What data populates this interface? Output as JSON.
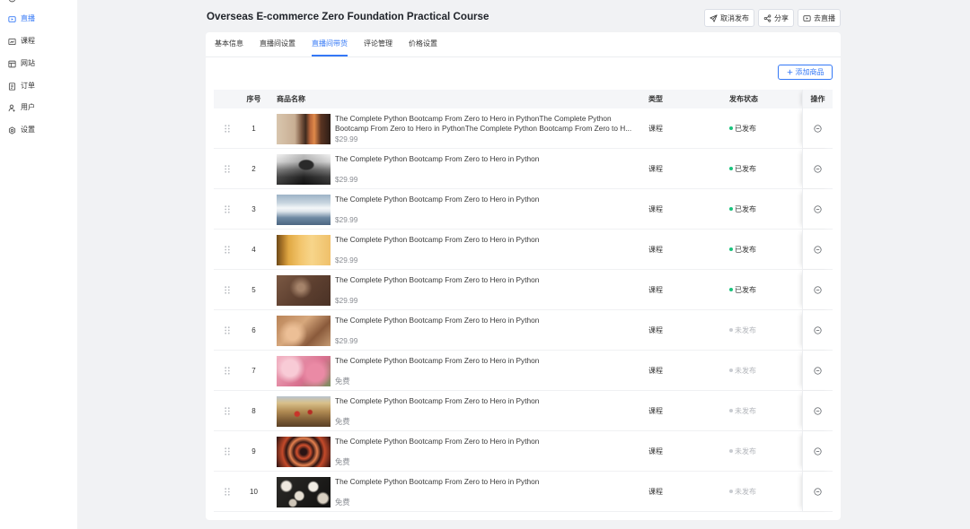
{
  "theme": {
    "accent": "#3478f6",
    "published": "#19c37d",
    "unpublished": "#c8cbd0"
  },
  "sidebar": {
    "items": [
      {
        "label": "直播",
        "icon": "video-icon",
        "active": true
      },
      {
        "label": "课程",
        "icon": "course-icon"
      },
      {
        "label": "网站",
        "icon": "website-icon"
      },
      {
        "label": "订单",
        "icon": "order-icon"
      },
      {
        "label": "用户",
        "icon": "user-icon"
      },
      {
        "label": "设置",
        "icon": "gear-icon"
      }
    ]
  },
  "header": {
    "title": "Overseas E-commerce Zero Foundation Practical Course",
    "actions": [
      {
        "label": "取消发布",
        "icon": "send-icon"
      },
      {
        "label": "分享",
        "icon": "share-icon"
      },
      {
        "label": "去直播",
        "icon": "video-icon"
      }
    ]
  },
  "tabs": [
    {
      "label": "基本信息"
    },
    {
      "label": "直播间设置"
    },
    {
      "label": "直播间带货",
      "active": true
    },
    {
      "label": "评论管理"
    },
    {
      "label": "价格设置"
    }
  ],
  "toolbar": {
    "add_label": "添加商品",
    "add_icon": "plus-icon"
  },
  "table": {
    "columns": {
      "index": "序号",
      "name": "商品名称",
      "type": "类型",
      "status": "发布状态",
      "actions": "操作"
    }
  },
  "products": [
    {
      "index": "1",
      "title": "The Complete Python Bootcamp From Zero to Hero in PythonThe Complete Python Bootcamp From Zero to Hero in PythonThe Complete Python Bootcamp From Zero to H...",
      "price": "$29.99",
      "type": "课程",
      "status": "已发布",
      "published": true
    },
    {
      "index": "2",
      "title": "The Complete Python Bootcamp From Zero to Hero in Python",
      "price": "$29.99",
      "type": "课程",
      "status": "已发布",
      "published": true
    },
    {
      "index": "3",
      "title": "The Complete Python Bootcamp From Zero to Hero in Python",
      "price": "$29.99",
      "type": "课程",
      "status": "已发布",
      "published": true
    },
    {
      "index": "4",
      "title": "The Complete Python Bootcamp From Zero to Hero in Python",
      "price": "$29.99",
      "type": "课程",
      "status": "已发布",
      "published": true
    },
    {
      "index": "5",
      "title": "The Complete Python Bootcamp From Zero to Hero in Python",
      "price": "$29.99",
      "type": "课程",
      "status": "已发布",
      "published": true
    },
    {
      "index": "6",
      "title": "The Complete Python Bootcamp From Zero to Hero in Python",
      "price": "$29.99",
      "type": "课程",
      "status": "未发布",
      "published": false
    },
    {
      "index": "7",
      "title": "The Complete Python Bootcamp From Zero to Hero in Python",
      "price": "免费",
      "type": "课程",
      "status": "未发布",
      "published": false
    },
    {
      "index": "8",
      "title": "The Complete Python Bootcamp From Zero to Hero in Python",
      "price": "免费",
      "type": "课程",
      "status": "未发布",
      "published": false
    },
    {
      "index": "9",
      "title": "The Complete Python Bootcamp From Zero to Hero in Python",
      "price": "免费",
      "type": "课程",
      "status": "未发布",
      "published": false
    },
    {
      "index": "10",
      "title": "The Complete Python Bootcamp From Zero to Hero in Python",
      "price": "免费",
      "type": "课程",
      "status": "未发布",
      "published": false
    }
  ]
}
